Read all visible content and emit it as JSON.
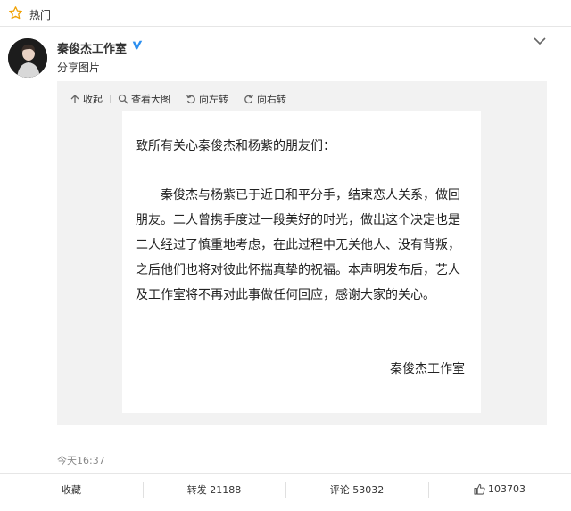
{
  "topbar": {
    "label": "热门"
  },
  "post": {
    "author": "秦俊杰工作室",
    "subtitle": "分享图片",
    "time": "今天16:37"
  },
  "toolbar": {
    "collapse": "收起",
    "view_large": "查看大图",
    "rotate_left": "向左转",
    "rotate_right": "向右转"
  },
  "letter": {
    "greeting": "致所有关心秦俊杰和杨紫的朋友们：",
    "body": "秦俊杰与杨紫已于近日和平分手，结束恋人关系，做回朋友。二人曾携手度过一段美好的时光，做出这个决定也是二人经过了慎重地考虑，在此过程中无关他人、没有背叛，之后他们也将对彼此怀揣真挚的祝福。本声明发布后，艺人及工作室将不再对此事做任何回应，感谢大家的关心。",
    "signature": "秦俊杰工作室"
  },
  "actions": {
    "favorite": "收藏",
    "repost": "转发 21188",
    "comment": "评论 53032",
    "like": "103703"
  },
  "colors": {
    "accent": "#f0a000",
    "verified": "#2b8ff0"
  }
}
